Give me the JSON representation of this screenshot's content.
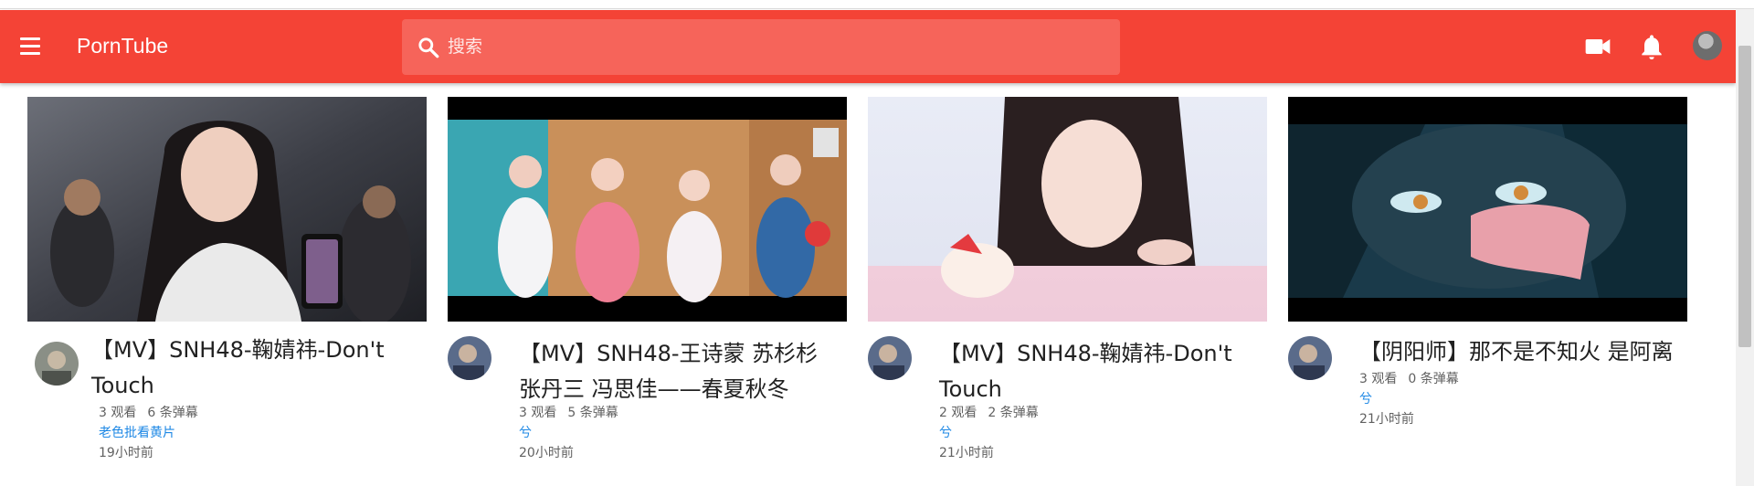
{
  "app": {
    "brand": "PornTube",
    "search_placeholder": "搜索"
  },
  "header_icons": [
    "menu-icon",
    "search-icon",
    "video-camera-icon",
    "bell-icon",
    "user-avatar"
  ],
  "colors": {
    "appbar": "#f44336",
    "channel_link": "#1e88e5",
    "title_text": "#212121",
    "meta_text": "#616161"
  },
  "videos": [
    {
      "title_line1": "【MV】SNH48-鞠婧祎-Don't",
      "title_line2": "Touch",
      "views": "3 观看",
      "danmaku": "6 条弹幕",
      "channel": "老色批看黄片",
      "time": "19小时前"
    },
    {
      "title_line1": "【MV】SNH48-王诗蒙 苏杉杉",
      "title_line2": "张丹三 冯思佳——春夏秋冬",
      "views": "3 观看",
      "danmaku": "5 条弹幕",
      "channel": "兮",
      "time": "20小时前"
    },
    {
      "title_line1": "【MV】SNH48-鞠婧祎-Don't",
      "title_line2": "Touch",
      "views": "2 观看",
      "danmaku": "2 条弹幕",
      "channel": "兮",
      "time": "21小时前"
    },
    {
      "title_line1": "【阴阳师】那不是不知火 是阿离",
      "title_line2": "",
      "views": "3 观看",
      "danmaku": "0 条弹幕",
      "channel": "兮",
      "time": "21小时前"
    }
  ]
}
